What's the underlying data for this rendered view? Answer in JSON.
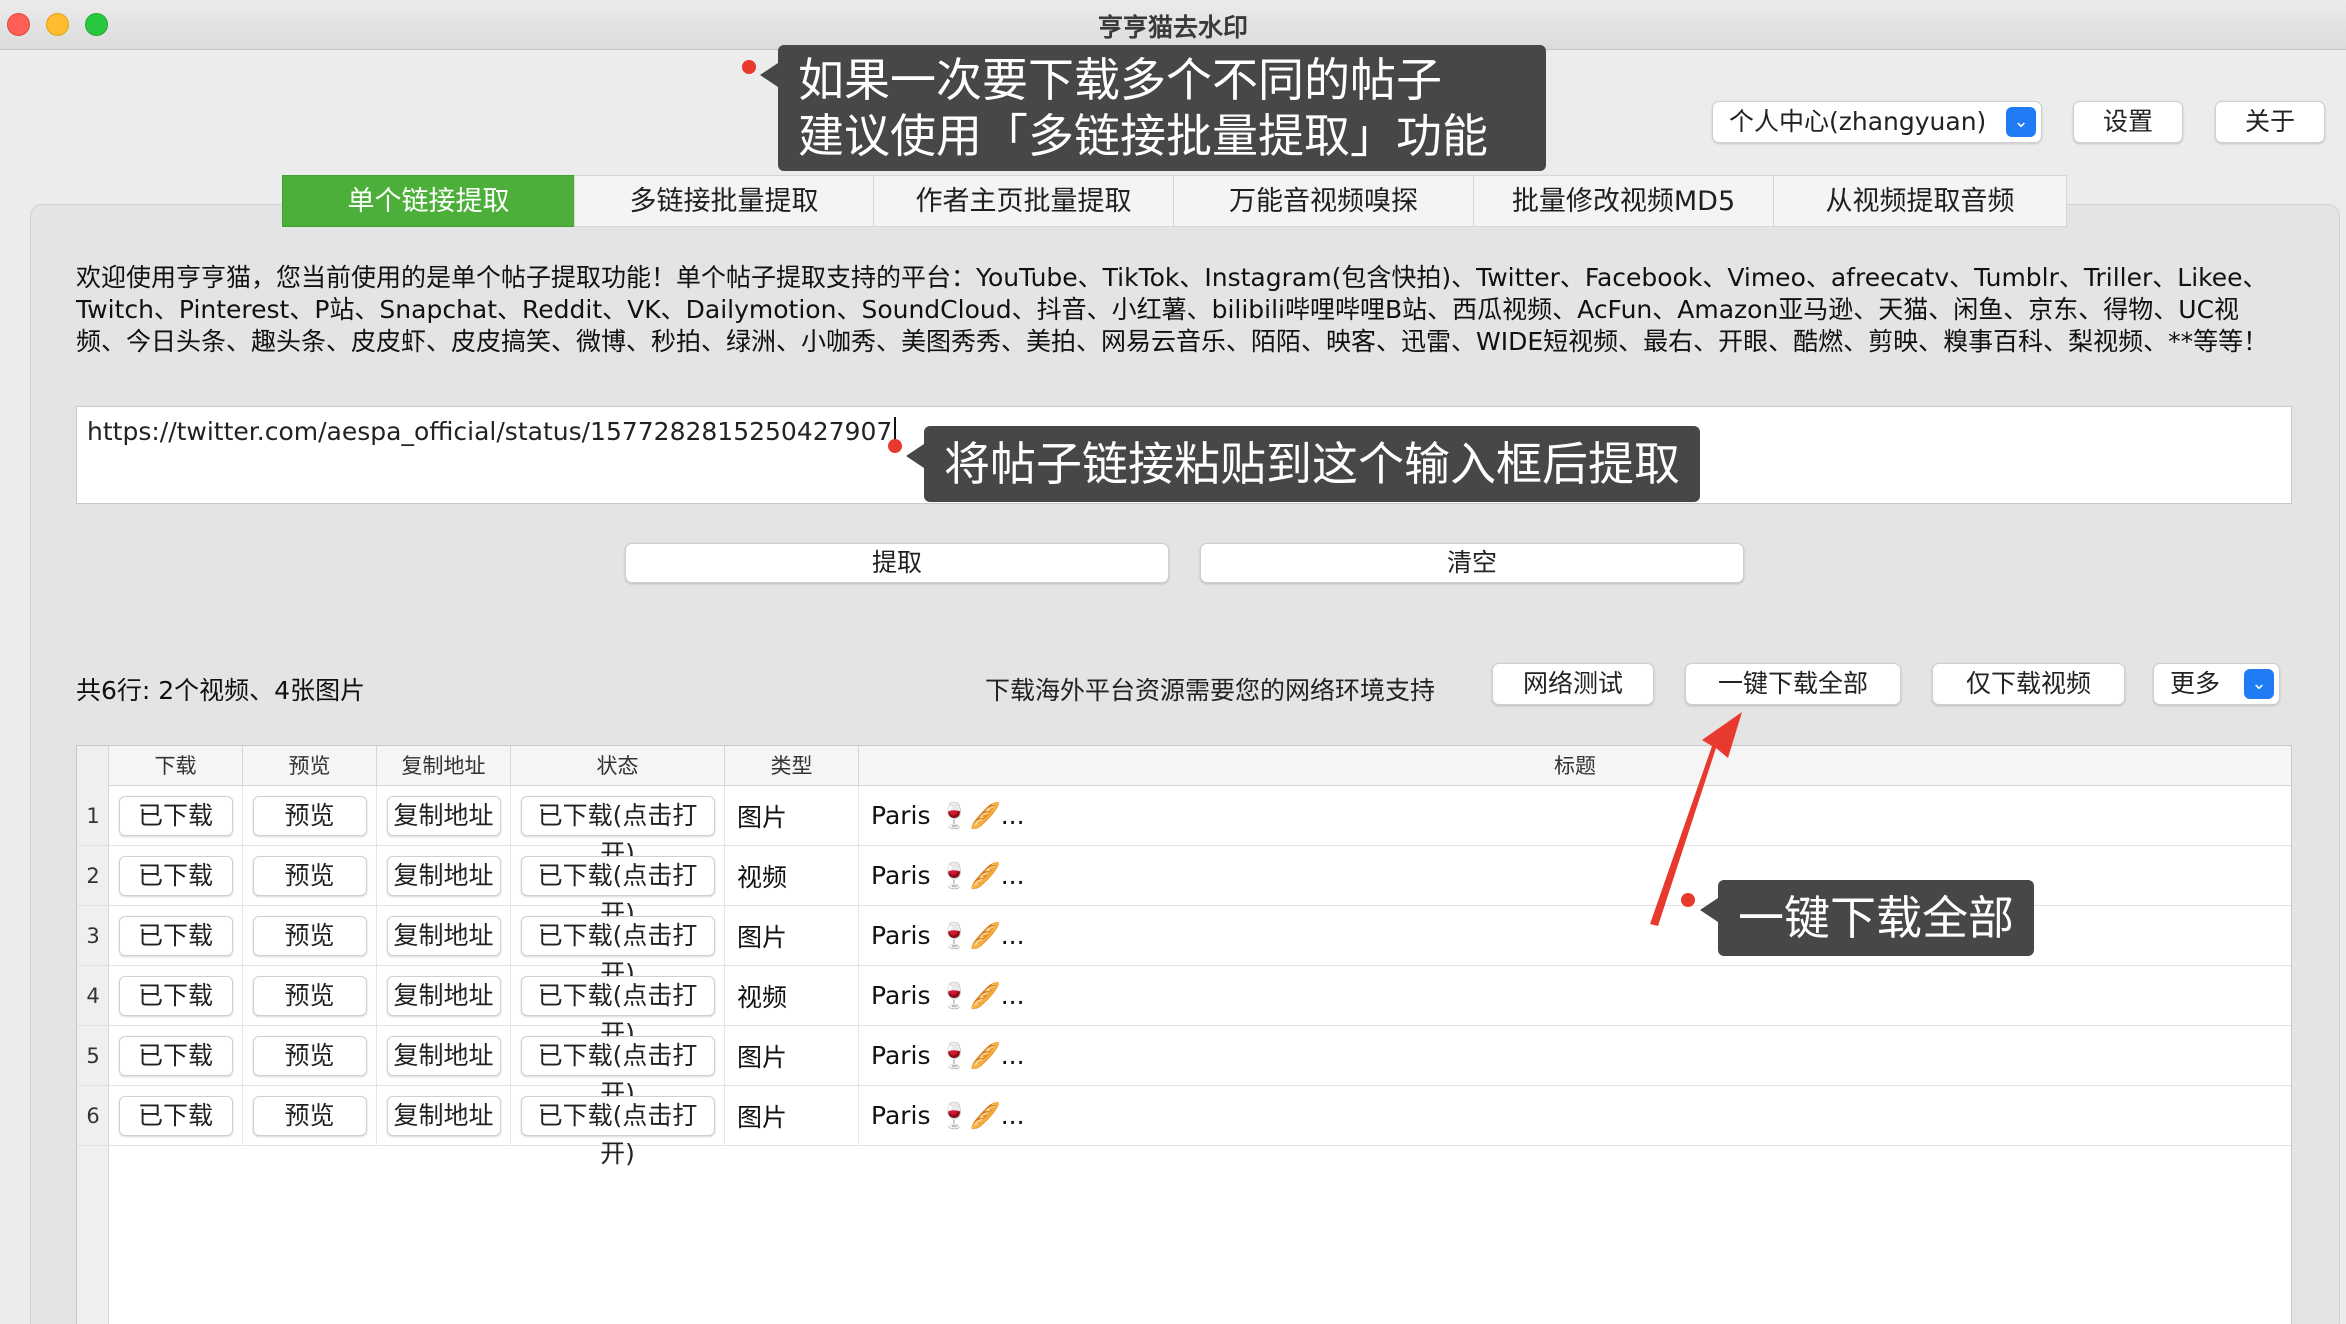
{
  "window": {
    "title": "亨亨猫去水印"
  },
  "header": {
    "user_select": "个人中心(zhangyuan)",
    "settings_label": "设置",
    "about_label": "关于"
  },
  "tabs": [
    {
      "label": "单个链接提取",
      "active": true
    },
    {
      "label": "多链接批量提取",
      "active": false
    },
    {
      "label": "作者主页批量提取",
      "active": false
    },
    {
      "label": "万能音视频嗅探",
      "active": false
    },
    {
      "label": "批量修改视频MD5",
      "active": false
    },
    {
      "label": "从视频提取音频",
      "active": false
    }
  ],
  "intro": "欢迎使用亨亨猫，您当前使用的是单个帖子提取功能！单个帖子提取支持的平台：YouTube、TikTok、Instagram(包含快拍)、Twitter、Facebook、Vimeo、afreecatv、Tumblr、Triller、Likee、Twitch、Pinterest、P站、Snapchat、Reddit、VK、Dailymotion、SoundCloud、抖音、小红薯、bilibili哔哩哔哩B站、西瓜视频、AcFun、Amazon亚马逊、天猫、闲鱼、京东、得物、UC视频、今日头条、趣头条、皮皮虾、皮皮搞笑、微博、秒拍、绿洲、小咖秀、美图秀秀、美拍、网易云音乐、陌陌、映客、迅雷、WIDE短视频、最右、开眼、酷燃、剪映、糗事百科、梨视频、**等等！",
  "url_input": {
    "value": "https://twitter.com/aespa_official/status/1577282815250427907"
  },
  "actions": {
    "extract_label": "提取",
    "clear_label": "清空"
  },
  "summary": "共6行: 2个视频、4张图片",
  "net_note": "下载海外平台资源需要您的网络环境支持",
  "toolbar": {
    "nettest_label": "网络测试",
    "download_all_label": "一键下载全部",
    "download_video_label": "仅下载视频",
    "more_label": "更多"
  },
  "table": {
    "columns": [
      "下载",
      "预览",
      "复制地址",
      "状态",
      "类型",
      "标题"
    ],
    "rows": [
      {
        "num": "1",
        "download": "已下载",
        "preview": "预览",
        "copy": "复制地址",
        "status": "已下载(点击打开)",
        "type": "图片",
        "title": "Paris 🍷🥖..."
      },
      {
        "num": "2",
        "download": "已下载",
        "preview": "预览",
        "copy": "复制地址",
        "status": "已下载(点击打开)",
        "type": "视频",
        "title": "Paris 🍷🥖..."
      },
      {
        "num": "3",
        "download": "已下载",
        "preview": "预览",
        "copy": "复制地址",
        "status": "已下载(点击打开)",
        "type": "图片",
        "title": "Paris 🍷🥖..."
      },
      {
        "num": "4",
        "download": "已下载",
        "preview": "预览",
        "copy": "复制地址",
        "status": "已下载(点击打开)",
        "type": "视频",
        "title": "Paris 🍷🥖..."
      },
      {
        "num": "5",
        "download": "已下载",
        "preview": "预览",
        "copy": "复制地址",
        "status": "已下载(点击打开)",
        "type": "图片",
        "title": "Paris 🍷🥖..."
      },
      {
        "num": "6",
        "download": "已下载",
        "preview": "预览",
        "copy": "复制地址",
        "status": "已下载(点击打开)",
        "type": "图片",
        "title": "Paris 🍷🥖..."
      }
    ]
  },
  "annotations": {
    "tip_batch_line1": "如果一次要下载多个不同的帖子",
    "tip_batch_line2": "建议使用「多链接批量提取」功能",
    "tip_paste": "将帖子链接粘贴到这个输入框后提取",
    "tip_download_all": "一键下载全部"
  },
  "colors": {
    "active_tab": "#4caf3a",
    "accent_blue": "#1f7cf4",
    "annotation_bg": "#474747",
    "annotation_red": "#e8392e"
  }
}
